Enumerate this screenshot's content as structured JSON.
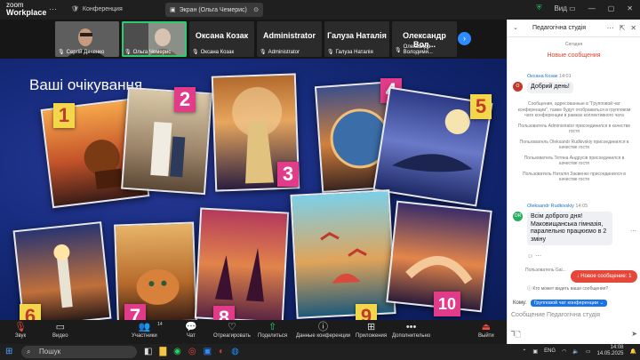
{
  "app": {
    "logo_line1": "zoom",
    "logo_line2": "Workplace",
    "menu_conference": "Конференция",
    "screen_share_label": "Экран (Ольга Чемерис)",
    "view_label": "Вид"
  },
  "participants": [
    {
      "name": "Сергій Дяченко",
      "active": false
    },
    {
      "name": "Ольга Чемерис",
      "active": true
    },
    {
      "name": "Оксана Козак",
      "big": "Оксана Козак",
      "active": false
    },
    {
      "name": "Administrator",
      "big": "Administrator",
      "active": false
    },
    {
      "name": "Галуза Наталія",
      "big": "Галуза Наталія",
      "active": false
    },
    {
      "name": "Олександр Володими...",
      "big": "Олександр Вол...",
      "active": false
    }
  ],
  "slide": {
    "title": "Ваші очікування",
    "numbers": [
      "1",
      "2",
      "3",
      "4",
      "5",
      "6",
      "7",
      "8",
      "9",
      "10"
    ]
  },
  "toolbar": {
    "items": [
      {
        "label": "Звук",
        "icon": "mic-muted-icon",
        "glyph": "🎙"
      },
      {
        "label": "Видео",
        "icon": "video-icon",
        "glyph": "▭"
      },
      {
        "label": "Участники",
        "icon": "participants-icon",
        "glyph": "👥"
      },
      {
        "label": "Чат",
        "icon": "chat-icon",
        "glyph": "💬"
      },
      {
        "label": "Отреагировать",
        "icon": "heart-icon",
        "glyph": "♡"
      },
      {
        "label": "Поделиться",
        "icon": "share-icon",
        "glyph": "⇧"
      },
      {
        "label": "Данные конференции",
        "icon": "info-icon",
        "glyph": "ⓘ"
      },
      {
        "label": "Приложения",
        "icon": "apps-icon",
        "glyph": "⊞"
      },
      {
        "label": "Дополнительно",
        "icon": "more-icon",
        "glyph": "•••"
      },
      {
        "label": "Выйти",
        "icon": "leave-icon",
        "glyph": "⏏"
      }
    ],
    "participants_count": "14"
  },
  "chat": {
    "title": "Педагогічна студія",
    "date_divider": "Сегодня",
    "new_messages_divider": "Новые сообщения",
    "msg1": {
      "name": "Оксана Козак",
      "time": "14:01",
      "avatar": "О",
      "text": "Добрий день!"
    },
    "sys_lines": [
      "Сообщения, адресованные в \"Групповой чат конференции\", также будут отображаться в групповом чате конференции в рамках коллективного чата",
      "Пользователь Administrator присоединился в качестве гостя",
      "Пользователь Oleksandr Rudkivskiy присоединился в качестве гостя",
      "Пользователь Тетяна Андрусів присоединился в качестве гостя",
      "Пользователь Наталія Заєвенко присоединился в качестве гостя"
    ],
    "msg2": {
      "name": "Oleksandr Rudkivskiy",
      "time": "14:05",
      "avatar": "OR",
      "text": "Всім доброго дня! Маковищанська гімназія, паралельно працюємо в 2 зміну"
    },
    "sys_last": "Пользователь Gal...",
    "new_message_button": "Новое сообщение: 1",
    "who_can_see": "Кто может видеть ваши сообщения?",
    "to_label": "Кому:",
    "to_value": "Групповой чат конференции",
    "compose_placeholder": "Сообщение Педагогічна студія"
  },
  "taskbar": {
    "search_placeholder": "Пошук",
    "lang": "ENG",
    "time": "14:08",
    "date": "14.05.2025"
  },
  "colors": {
    "accent": "#2d8cff",
    "new_msg": "#e5483a",
    "active_speaker": "#2ecc71"
  }
}
